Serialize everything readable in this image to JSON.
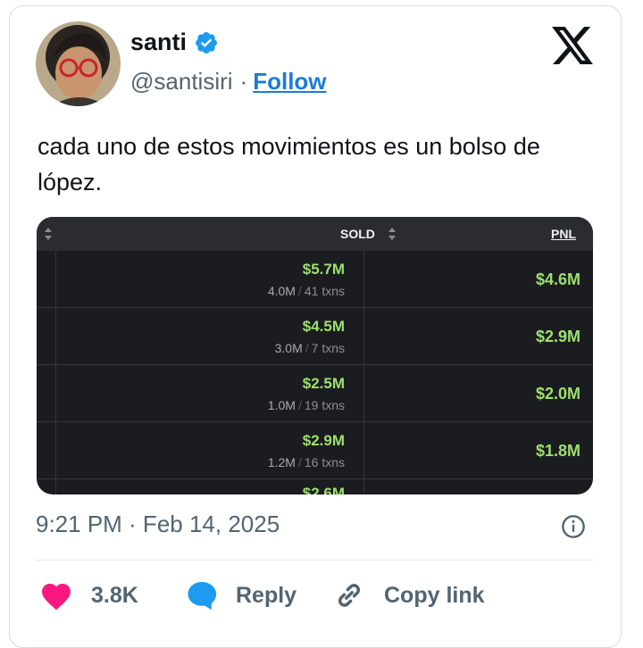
{
  "author": {
    "name": "santi",
    "handle": "@santisiri",
    "separator": "·",
    "follow_label": "Follow"
  },
  "tweet": {
    "text": "cada uno de estos movimientos es un bolso de lópez.",
    "timestamp": "9:21 PM · Feb 14, 2025"
  },
  "table": {
    "columns": [
      "SOLD",
      "PNL"
    ],
    "rows": [
      {
        "sold": "$5.7M",
        "amount": "4.0M",
        "txns": "41 txns",
        "pnl": "$4.6M"
      },
      {
        "sold": "$4.5M",
        "amount": "3.0M",
        "txns": "7 txns",
        "pnl": "$2.9M"
      },
      {
        "sold": "$2.5M",
        "amount": "1.0M",
        "txns": "19 txns",
        "pnl": "$2.0M"
      },
      {
        "sold": "$2.9M",
        "amount": "1.2M",
        "txns": "16 txns",
        "pnl": "$1.8M"
      }
    ],
    "partial_row_sold": "$2.6M"
  },
  "actions": {
    "likes": "3.8K",
    "reply_label": "Reply",
    "copy_label": "Copy link"
  },
  "colors": {
    "accent": "#1d9bf0",
    "like": "#f91880",
    "positive": "#9de06e",
    "text_secondary": "#536471"
  },
  "icons": [
    "verified-badge-icon",
    "x-logo-icon",
    "sort-icon",
    "info-icon",
    "heart-icon",
    "reply-bubble-icon",
    "link-icon"
  ]
}
